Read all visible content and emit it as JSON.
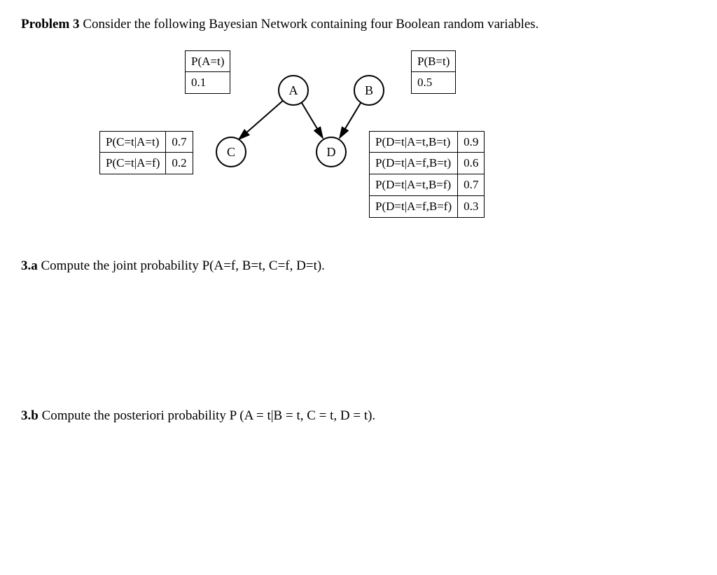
{
  "problem": {
    "label": "Problem 3",
    "text": " Consider the following Bayesian Network containing four Boolean random variables."
  },
  "nodes": {
    "A": "A",
    "B": "B",
    "C": "C",
    "D": "D"
  },
  "tables": {
    "A": {
      "header": "P(A=t)",
      "value": "0.1"
    },
    "B": {
      "header": "P(B=t)",
      "value": "0.5"
    },
    "C": {
      "rows": [
        {
          "label": "P(C=t|A=t)",
          "value": "0.7"
        },
        {
          "label": "P(C=t|A=f)",
          "value": "0.2"
        }
      ]
    },
    "D": {
      "rows": [
        {
          "label": "P(D=t|A=t,B=t)",
          "value": "0.9"
        },
        {
          "label": "P(D=t|A=f,B=t)",
          "value": "0.6"
        },
        {
          "label": "P(D=t|A=t,B=f)",
          "value": "0.7"
        },
        {
          "label": "P(D=t|A=f,B=f)",
          "value": "0.3"
        }
      ]
    }
  },
  "questions": {
    "a": {
      "label": "3.a",
      "text": " Compute the joint probability P(A=f, B=t, C=f, D=t)."
    },
    "b": {
      "label": "3.b",
      "text": " Compute the posteriori probability P (A = t|B = t, C = t, D = t)."
    }
  }
}
